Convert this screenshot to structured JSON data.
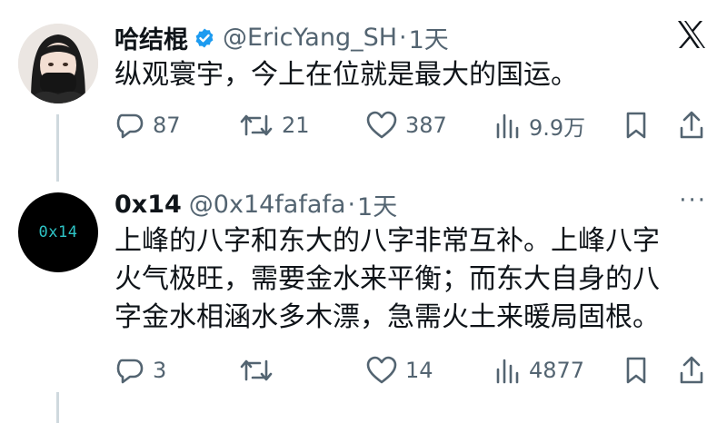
{
  "tweet1": {
    "name": "哈结棍",
    "handle": "@EricYang_SH",
    "separator": "·",
    "time": "1天",
    "text": "纵观寰宇，今上在位就是最大的国运。",
    "replies": "87",
    "retweets": "21",
    "likes": "387",
    "views": "9.9万"
  },
  "tweet2": {
    "name": "0x14",
    "handle": "@0x14fafafa",
    "separator": "·",
    "time": "1天",
    "avatar_text": "0x14",
    "text_line1": "上峰的八字和东大的八字非常互补。上峰八字",
    "text_line2": "火气极旺，需要金水来平衡；而东大自身的八",
    "text_line3": "字金水相涵水多木漂，急需火土来暖局固根。",
    "replies": "3",
    "retweets": "",
    "likes": "14",
    "views": "4877"
  },
  "more_label": "···",
  "colors": {
    "accent": "#1d9bf0",
    "muted": "#536471",
    "text": "#0f1419",
    "line": "#cfd9de"
  },
  "icons": [
    "verified-badge-icon",
    "x-logo-icon",
    "reply-icon",
    "retweet-icon",
    "like-icon",
    "views-icon",
    "bookmark-icon",
    "share-icon",
    "more-icon"
  ]
}
